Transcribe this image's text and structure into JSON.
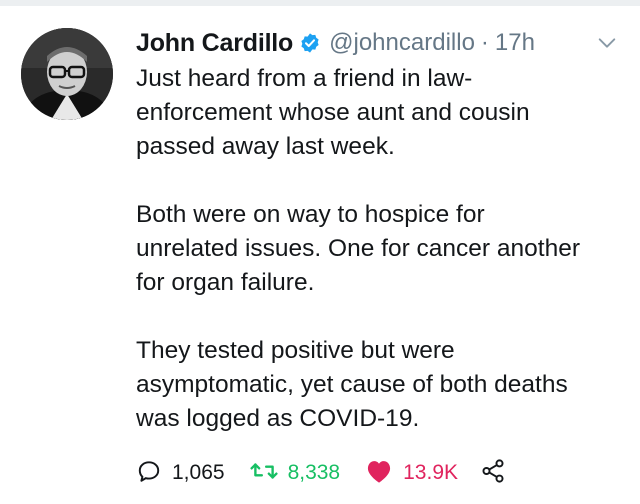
{
  "tweet": {
    "author": {
      "display_name": "John Cardillo",
      "handle": "@johncardillo",
      "verified": true,
      "avatar_icon": "profile-photo"
    },
    "separator": "·",
    "timestamp": "17h",
    "paragraphs": [
      "Just heard from a friend in law-\nenforcement whose aunt and cousin\npassed away last week.",
      "Both were on way to hospice for\nunrelated issues. One for cancer another\nfor organ failure.",
      "They tested positive but were\nasymptomatic, yet cause of both deaths\nwas logged as COVID-19."
    ],
    "actions": {
      "replies": "1,065",
      "retweets": "8,338",
      "likes": "13.9K"
    }
  },
  "icons": {
    "verified": "verified-badge-icon",
    "menu": "chevron-down-icon",
    "reply": "reply-icon",
    "retweet": "retweet-icon",
    "like": "heart-icon",
    "share": "share-icon"
  },
  "colors": {
    "text": "#14171a",
    "secondary": "#657786",
    "verified": "#1da1f2",
    "retweet": "#17bf63",
    "like": "#e0245e"
  }
}
